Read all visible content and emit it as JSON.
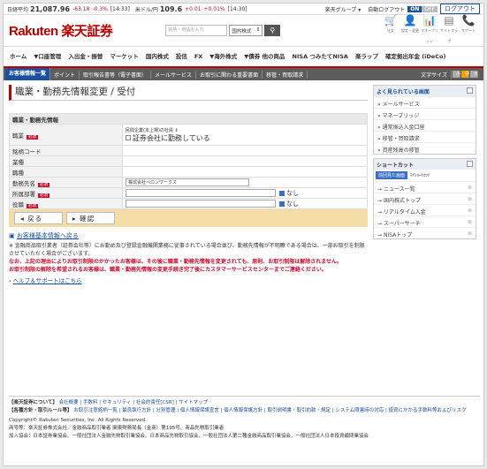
{
  "ticker": {
    "nikkei_label": "日経平均",
    "nikkei": "21,087.96",
    "nikkei_chg": "-63.18",
    "nikkei_pct": "-0.3%",
    "nikkei_time": "[14:33]",
    "usd_label": "米ドル/円",
    "usd": "109.6",
    "usd_chg": "+0.01",
    "usd_pct": "+0.01%",
    "usd_time": "[14:30]",
    "group": "楽天グループ ▾",
    "autologout": "自動ログアウト",
    "on": "ON",
    "off": "OFF",
    "logout": "ログアウト"
  },
  "header": {
    "logo": "Rakuten 楽天証券",
    "search_placeholder": "銘柄・用語を入力",
    "market": "国内株式",
    "icons": [
      {
        "name": "cart-icon",
        "glyph": "🛒",
        "label": "注文"
      },
      {
        "name": "user-icon",
        "glyph": "👤",
        "label": "設定・変更"
      },
      {
        "name": "chart-icon",
        "glyph": "📊",
        "label": "マネーブリッジ"
      },
      {
        "name": "sitemap-icon",
        "glyph": "▤",
        "label": "サイトマップ"
      },
      {
        "name": "phone-icon",
        "glyph": "📞",
        "label": "サポート"
      }
    ]
  },
  "nav": [
    "ホーム",
    "▼口座管理",
    "入出金・振替",
    "マーケット",
    "国内株式",
    "投信",
    "FX",
    "▼海外株式",
    "▼債券 他の商品",
    "NISA つみたてNISA",
    "楽ラップ",
    "確定拠出年金 (iDeCo)"
  ],
  "subnav": {
    "items": [
      "お客様情報一覧",
      "ポイント",
      "取引報告書等（電子書面）",
      "メールサービス",
      "お取引に関わる重要書面",
      "移管・買取請求"
    ],
    "font_size": "文字サイズ",
    "sizes": [
      "小",
      "中",
      "大"
    ]
  },
  "main": {
    "title": "職業・勤務先情報変更 / 受付",
    "section": "職業・勤務先情報",
    "required": "必須",
    "rows": [
      {
        "label": "職業",
        "req": true,
        "value": "民間企業(本上場)の社員 ⇕",
        "sub": "証券会社に勤務している"
      },
      {
        "label": "銘柄コード"
      },
      {
        "label": "業種"
      },
      {
        "label": "職種"
      },
      {
        "label": "勤務先名",
        "req": true,
        "value": "株式会社ペロンワークス"
      },
      {
        "label": "所属部署",
        "req": true,
        "check": "なし"
      },
      {
        "label": "役職",
        "req": true,
        "check": "なし"
      }
    ],
    "back": "戻る",
    "confirm": "確認",
    "basic_link": "お客様基本情報へ戻る",
    "note": "※ 金融商品取引業者（証券会社等）にお勤め及び登録金融機関業務に従事されている場合並び、勤務先情報が不明瞭である場合は、一部お取引を制限させていただく場合がございます。",
    "warn1": "なお、上記の理由によりお取引制限のかかったお客様は、その後に職業・勤務先情報を変更されても、原則、お取引制限は解除されません。",
    "warn2": "お取引制限の解除を希望されるお客様は、職業・勤務先情報の変更手続き完了後にカスタマーサービスセンターまでご連絡ください。",
    "help": "ヘルプ＆サポートはこちら"
  },
  "side": {
    "popular": "よく見られている画面",
    "popular_items": [
      "メールサービス",
      "マネーブリッジ",
      "通常振込入金口座",
      "移管・買取請求",
      "資産残高の移管"
    ],
    "shortcut": "ショートカット",
    "tabs": [
      "前回見た画面",
      "ﾏｲｼｮｰﾄｶｯﾄ"
    ],
    "shortcuts": [
      "ニュース一覧",
      "国内株式トップ",
      "リアルタイム入金",
      "スーパーサーチ",
      "NISAトップ"
    ]
  },
  "footer": {
    "about_label": "【楽天証券について】",
    "about": "会社概要 | 手数料 | セキュリティ | 社会的責任[CSR] | サイトマップ",
    "policy_label": "【各種方針・取引ルール等】",
    "policy": "お取引注意銘柄一覧 | 最良執行方針 | 分別管理 | 個人情報保護宣言 | 個人情報保護方針 | 取引説明書・取引約款・規定 | システム障害時の対応 | 投資にかかる手数料等およびリスク",
    "copyright": "Copyright© Rakuten Securities, Inc. All Rights Reserved.",
    "company": "商号等：楽天証券株式会社／金融商品取引業者 関東財務局長（金商）第195号、商品先物取引業者",
    "assoc": "加入協会：日本証券業協会、一般社団法人金融先物取引業協会、日本商品先物取引協会、一般社団法人第二種金融商品取引業協会、一般社団法人日本投資顧問業協会"
  }
}
